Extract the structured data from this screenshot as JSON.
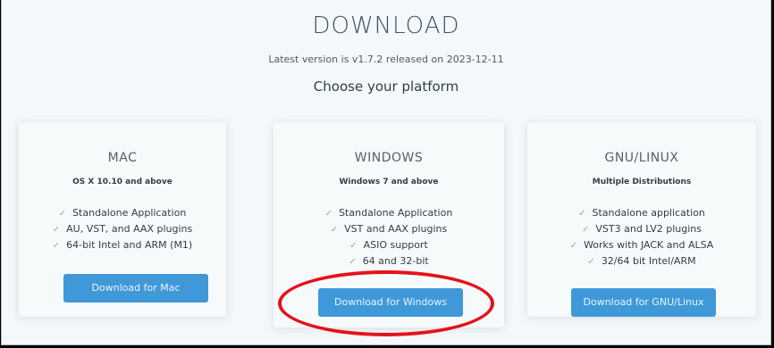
{
  "page": {
    "title": "DOWNLOAD",
    "subtitle": "Latest version is v1.7.2 released on 2023-12-11",
    "choose": "Choose your platform"
  },
  "platforms": [
    {
      "name": "MAC",
      "requirement": "OS X 10.10 and above",
      "features": [
        "Standalone Application",
        "AU, VST, and AAX plugins",
        "64-bit Intel and ARM (M1)"
      ],
      "button": "Download for Mac"
    },
    {
      "name": "WINDOWS",
      "requirement": "Windows 7 and above",
      "features": [
        "Standalone Application",
        "VST and AAX plugins",
        "ASIO support",
        "64 and 32-bit"
      ],
      "button": "Download for Windows"
    },
    {
      "name": "GNU/LINUX",
      "requirement": "Multiple Distributions",
      "features": [
        "Standalone application",
        "VST3 and LV2 plugins",
        "Works with JACK and ALSA",
        "32/64 bit Intel/ARM"
      ],
      "button": "Download for GNU/Linux"
    }
  ],
  "icons": {
    "check": "checkmark-icon"
  },
  "colors": {
    "button": "#3f99d8",
    "check": "#6cc58a",
    "highlight": "#e5121b"
  }
}
